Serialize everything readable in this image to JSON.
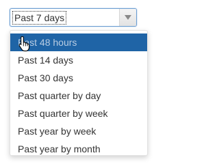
{
  "select": {
    "value": "Past 7 days",
    "arrow_icon": "chevron-down-icon"
  },
  "menu": {
    "options": [
      {
        "label": "Past 48 hours",
        "selected": true
      },
      {
        "label": "Past 14 days",
        "selected": false
      },
      {
        "label": "Past 30 days",
        "selected": false
      },
      {
        "label": "Past quarter by day",
        "selected": false
      },
      {
        "label": "Past quarter by week",
        "selected": false
      },
      {
        "label": "Past year by week",
        "selected": false
      },
      {
        "label": "Past year by month",
        "selected": false
      }
    ]
  },
  "cursor": {
    "icon": "hand-pointer-icon"
  },
  "colors": {
    "highlight": "#1f64a6",
    "focus_border": "#6e9fd1",
    "text": "#333333"
  }
}
